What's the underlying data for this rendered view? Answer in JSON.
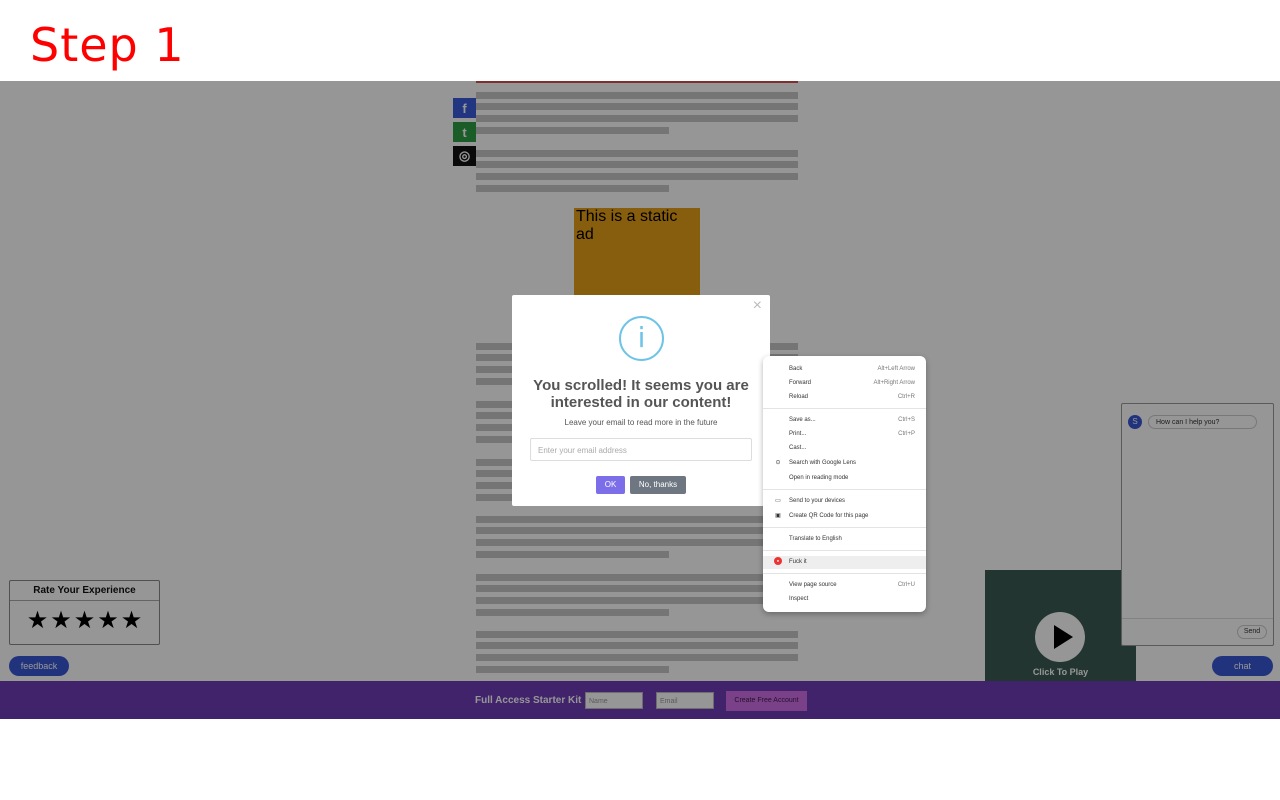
{
  "step_label": "Step 1",
  "article": {
    "ad_text": "This is a static ad",
    "social": [
      {
        "name": "facebook",
        "glyph": "f",
        "color": "#3b5bdb"
      },
      {
        "name": "twitter",
        "glyph": "t",
        "color": "#2f9e44"
      },
      {
        "name": "instagram",
        "glyph": "◎",
        "color": "#111111"
      }
    ]
  },
  "modal": {
    "icon": "i",
    "title": "You scrolled! It seems you are interested in our content!",
    "text": "Leave your email to read more in the future",
    "email_placeholder": "Enter your email address",
    "ok_label": "OK",
    "no_label": "No, thanks",
    "close_label": "×"
  },
  "context_menu": {
    "items": [
      {
        "label": "Back",
        "shortcut": "Alt+Left Arrow"
      },
      {
        "label": "Forward",
        "shortcut": "Alt+Right Arrow"
      },
      {
        "label": "Reload",
        "shortcut": "Ctrl+R"
      },
      {
        "label": "Save as...",
        "shortcut": "Ctrl+S"
      },
      {
        "label": "Print...",
        "shortcut": "Ctrl+P"
      },
      {
        "label": "Cast...",
        "shortcut": ""
      },
      {
        "label": "Search with Google Lens",
        "shortcut": ""
      },
      {
        "label": "Open in reading mode",
        "shortcut": ""
      },
      {
        "label": "Send to your devices",
        "shortcut": ""
      },
      {
        "label": "Create QR Code for this page",
        "shortcut": ""
      },
      {
        "label": "Translate to English",
        "shortcut": ""
      },
      {
        "label": "Fuck it",
        "shortcut": ""
      },
      {
        "label": "View page source",
        "shortcut": "Ctrl+U"
      },
      {
        "label": "Inspect",
        "shortcut": ""
      }
    ]
  },
  "rating": {
    "title": "Rate Your Experience",
    "stars": 5
  },
  "feedback_label": "feedback",
  "video": {
    "label": "Click To Play"
  },
  "chat": {
    "avatar_letter": "S",
    "message": "How can I help you?",
    "send_label": "Send",
    "button_label": "chat"
  },
  "footer": {
    "title": "Full Access Starter Kit",
    "name_placeholder": "Name",
    "email_placeholder": "Email",
    "button_label": "Create Free Account"
  }
}
